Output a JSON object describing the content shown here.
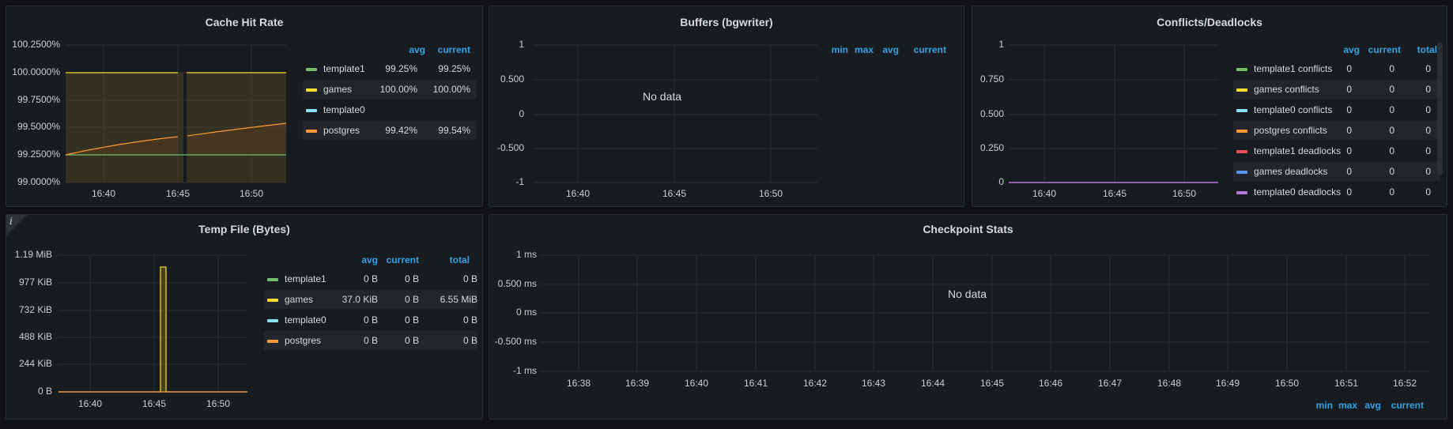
{
  "colors": {
    "green": "#73bf69",
    "yellow": "#fade2a",
    "cyan": "#8ae1f4",
    "orange": "#ff9830",
    "red": "#f2495c",
    "blue": "#5794f2",
    "purple": "#b877d9",
    "grid": "#2c3037",
    "header": "#33a2e5"
  },
  "cache_hit_rate": {
    "title": "Cache Hit Rate",
    "y_ticks": [
      "100.2500%",
      "100.0000%",
      "99.7500%",
      "99.5000%",
      "99.2500%",
      "99.0000%"
    ],
    "x_ticks": [
      "16:40",
      "16:45",
      "16:50"
    ],
    "legend_headers": [
      "avg",
      "current"
    ],
    "legend": [
      {
        "name": "template1",
        "color": "green",
        "avg": "99.25%",
        "current": "99.25%"
      },
      {
        "name": "games",
        "color": "yellow",
        "avg": "100.00%",
        "current": "100.00%"
      },
      {
        "name": "template0",
        "color": "cyan",
        "avg": "",
        "current": ""
      },
      {
        "name": "postgres",
        "color": "orange",
        "avg": "99.42%",
        "current": "99.54%"
      }
    ]
  },
  "buffers": {
    "title": "Buffers (bgwriter)",
    "y_ticks": [
      "1",
      "0.500",
      "0",
      "-0.500",
      "-1"
    ],
    "x_ticks": [
      "16:40",
      "16:45",
      "16:50"
    ],
    "legend_headers": [
      "min",
      "max",
      "avg",
      "current"
    ],
    "no_data": "No data"
  },
  "conflicts": {
    "title": "Conflicts/Deadlocks",
    "y_ticks": [
      "1",
      "0.750",
      "0.500",
      "0.250",
      "0"
    ],
    "x_ticks": [
      "16:40",
      "16:45",
      "16:50"
    ],
    "legend_headers": [
      "avg",
      "current",
      "total"
    ],
    "legend": [
      {
        "name": "template1 conflicts",
        "color": "green",
        "avg": "0",
        "current": "0",
        "total": "0"
      },
      {
        "name": "games conflicts",
        "color": "yellow",
        "avg": "0",
        "current": "0",
        "total": "0"
      },
      {
        "name": "template0 conflicts",
        "color": "cyan",
        "avg": "0",
        "current": "0",
        "total": "0"
      },
      {
        "name": "postgres conflicts",
        "color": "orange",
        "avg": "0",
        "current": "0",
        "total": "0"
      },
      {
        "name": "template1 deadlocks",
        "color": "red",
        "avg": "0",
        "current": "0",
        "total": "0"
      },
      {
        "name": "games deadlocks",
        "color": "blue",
        "avg": "0",
        "current": "0",
        "total": "0"
      },
      {
        "name": "template0 deadlocks",
        "color": "purple",
        "avg": "0",
        "current": "0",
        "total": "0"
      }
    ]
  },
  "temp_file": {
    "title": "Temp File (Bytes)",
    "info_glyph": "i",
    "y_ticks": [
      "1.19 MiB",
      "977 KiB",
      "732 KiB",
      "488 KiB",
      "244 KiB",
      "0 B"
    ],
    "x_ticks": [
      "16:40",
      "16:45",
      "16:50"
    ],
    "legend_headers": [
      "avg",
      "current",
      "total"
    ],
    "legend": [
      {
        "name": "template1",
        "color": "green",
        "avg": "0 B",
        "current": "0 B",
        "total": "0 B"
      },
      {
        "name": "games",
        "color": "yellow",
        "avg": "37.0 KiB",
        "current": "0 B",
        "total": "6.55 MiB"
      },
      {
        "name": "template0",
        "color": "cyan",
        "avg": "0 B",
        "current": "0 B",
        "total": "0 B"
      },
      {
        "name": "postgres",
        "color": "orange",
        "avg": "0 B",
        "current": "0 B",
        "total": "0 B"
      }
    ]
  },
  "checkpoint": {
    "title": "Checkpoint Stats",
    "y_ticks": [
      "1 ms",
      "0.500 ms",
      "0 ms",
      "-0.500 ms",
      "-1 ms"
    ],
    "x_ticks": [
      "16:38",
      "16:39",
      "16:40",
      "16:41",
      "16:42",
      "16:43",
      "16:44",
      "16:45",
      "16:46",
      "16:47",
      "16:48",
      "16:49",
      "16:50",
      "16:51",
      "16:52"
    ],
    "legend_headers": [
      "min",
      "max",
      "avg",
      "current"
    ],
    "no_data": "No data"
  }
}
